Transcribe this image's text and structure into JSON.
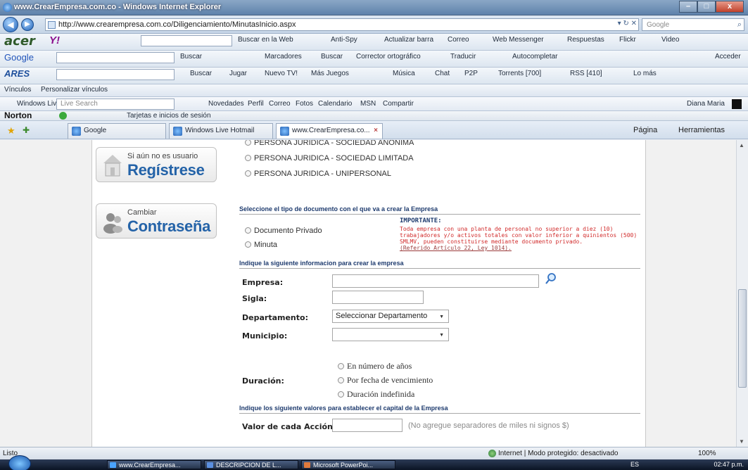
{
  "window": {
    "title": "www.CrearEmpresa.com.co - Windows Internet Explorer",
    "minimize": "–",
    "maximize": "□",
    "close": "x"
  },
  "address": {
    "url": "http://www.crearempresa.com.co/Diligenciamiento/MinutasInicio.aspx",
    "search_placeholder": "Google"
  },
  "toolbars": {
    "acer_logo": "acer",
    "yahoo_logo": "Y!",
    "acer_row": [
      "Buscar en la Web",
      "Anti-Spy",
      "Actualizar barra",
      "Correo",
      "Web Messenger",
      "Respuestas",
      "Flickr",
      "Video"
    ],
    "google_logo": "Google",
    "google_row": [
      "Buscar",
      "Marcadores",
      "Buscar",
      "Corrector ortográfico",
      "Traducir",
      "Autocompletar",
      "Acceder"
    ],
    "ares_logo": "ARES",
    "ares_row": [
      "Buscar",
      "Jugar",
      "Nuevo TV!",
      "Más Juegos",
      "Música",
      "Chat",
      "P2P",
      "Torrents [700]",
      "RSS [410]",
      "Lo más"
    ],
    "links": [
      "Vínculos",
      "Personalizar vínculos"
    ],
    "live_row": [
      "Windows Live",
      "Live Search",
      "Novedades",
      "Perfil",
      "Correo",
      "Fotos",
      "Calendario",
      "MSN",
      "Compartir",
      "Diana Maria"
    ],
    "norton": [
      "Norton",
      "Tarjetas e inicios de sesión"
    ]
  },
  "tabs": {
    "items": [
      "Google",
      "Windows Live Hotmail",
      "www.CrearEmpresa.co..."
    ],
    "right": [
      "Página",
      "Herramientas"
    ]
  },
  "sidebar": {
    "register": {
      "small": "Si aún no es usuario",
      "big": "Regístrese"
    },
    "password": {
      "small": "Cambiar",
      "big": "Contraseña"
    }
  },
  "form": {
    "person_types": [
      "PERSONA JURIDICA - SOCIEDAD ANONIMA",
      "PERSONA JURIDICA - SOCIEDAD LIMITADA",
      "PERSONA JURIDICA - UNIPERSONAL"
    ],
    "doc_section": "Seleccione el tipo de documento con el que va a crear la Empresa",
    "doc_types": [
      "Documento Privado",
      "Minuta"
    ],
    "important_title": "IMPORTANTE:",
    "important_text": "Toda empresa con una planta de personal no superior a diez (10) trabajadores y/o activos totales con valor inferior a quinientos (500) SMLMV, pueden constituirse mediante documento privado.",
    "important_ref": "(Referido Artículo 22, Ley 1014).",
    "info_section": "Indique la siguiente informacion para crear la empresa",
    "empresa_label": "Empresa:",
    "sigla_label": "Sigla:",
    "departamento_label": "Departamento:",
    "departamento_value": "Seleccionar Departamento",
    "municipio_label": "Municipio:",
    "duracion_label": "Duración:",
    "duracion_options": [
      "En número de años",
      "Por fecha de vencimiento",
      "Duración indefinida"
    ],
    "capital_section": "Indique los siguiente valores para establecer el capital de la Empresa",
    "valor_label": "Valor de cada Acción:",
    "valor_hint": "(No agregue separadores de miles ni signos $)"
  },
  "status": {
    "left": "Listo",
    "zone": "Internet | Modo protegido: desactivado",
    "zoom": "100%"
  },
  "taskbar": {
    "items": [
      "www.CrearEmpresa...",
      "DESCRIPCION DE L...",
      "Microsoft PowerPoi..."
    ],
    "lang": "ES",
    "clock": "02:47 p.m."
  },
  "colors": {
    "accent": "#2463a8",
    "important": "#d12b2b",
    "section": "#1e3b6e"
  }
}
